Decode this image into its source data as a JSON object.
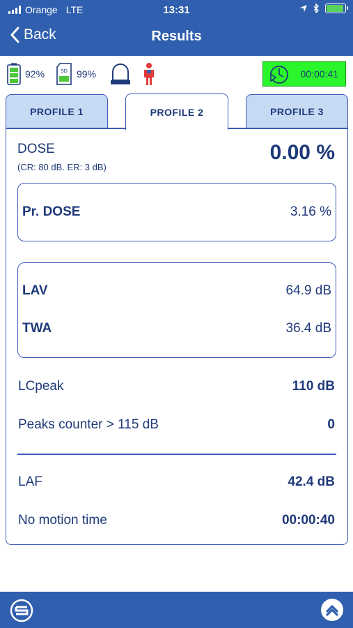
{
  "status": {
    "carrier": "Orange",
    "network": "LTE",
    "time": "13:31",
    "phone_battery_level": 0.95
  },
  "nav": {
    "back_label": "Back",
    "title": "Results"
  },
  "indicators": {
    "battery_percent": "92%",
    "sd_percent": "99%",
    "sd_icon_text": "SD",
    "timer": "00:00:41",
    "timer_color": "#2bf52b"
  },
  "tabs": [
    {
      "label": "PROFILE 1",
      "active": false
    },
    {
      "label": "PROFILE 2",
      "active": true
    },
    {
      "label": "PROFILE 3",
      "active": false
    }
  ],
  "results": {
    "dose_label": "DOSE",
    "dose_sub": "(CR: 80 dB. ER: 3 dB)",
    "dose_value": "0.00 %",
    "pr_dose_label": "Pr. DOSE",
    "pr_dose_value": "3.16 %",
    "lav_label": "LAV",
    "lav_value": "64.9 dB",
    "twa_label": "TWA",
    "twa_value": "36.4 dB",
    "lcpeak_label": "LCpeak",
    "lcpeak_value": "110 dB",
    "peaks_label": "Peaks counter > 115 dB",
    "peaks_value": "0",
    "laf_label": "LAF",
    "laf_value": "42.4 dB",
    "no_motion_label": "No motion time",
    "no_motion_value": "00:00:40"
  },
  "colors": {
    "header_blue": "#2f5fae",
    "text_navy": "#1f3a7a",
    "tab_inactive": "#c7daf3"
  }
}
